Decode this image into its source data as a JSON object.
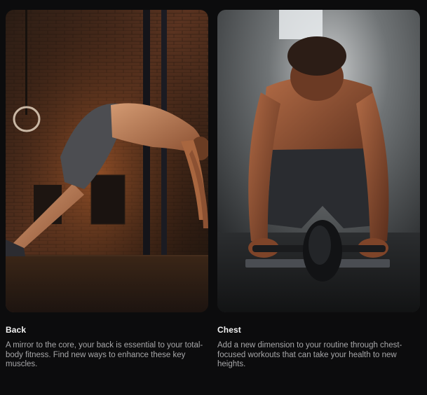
{
  "cards": [
    {
      "title": "Back",
      "description": "A mirror to the core, your back is essential to your total-body fitness. Find new ways to enhance these key muscles.",
      "image": "man-doing-back-exercise-in-brick-gym"
    },
    {
      "title": "Chest",
      "description": "Add a new dimension to your routine through chest-focused workouts that can take your health to new heights.",
      "image": "man-using-ab-roller-in-dark-gym"
    }
  ],
  "colors": {
    "background": "#0c0c0d",
    "title": "#f2f2f2",
    "description": "#a7a7a9"
  }
}
